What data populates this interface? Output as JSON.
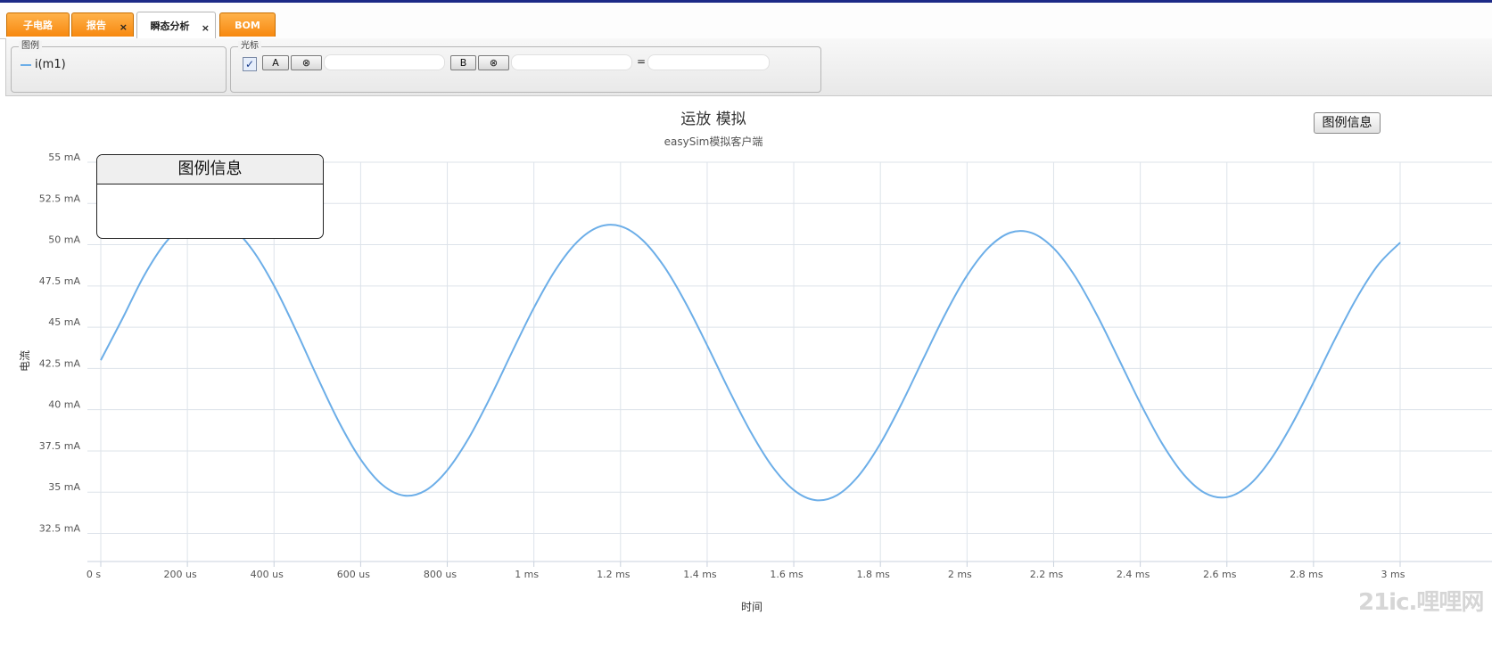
{
  "tabs": [
    {
      "label": "子电路",
      "active": false,
      "closable": false
    },
    {
      "label": "报告",
      "active": false,
      "closable": true
    },
    {
      "label": "瞬态分析",
      "active": true,
      "closable": true
    },
    {
      "label": "BOM",
      "active": false,
      "closable": false
    }
  ],
  "close_glyph": "×",
  "legend_panel": {
    "title": "图例",
    "entry": "i(m1)",
    "entry_color": "#6caee8"
  },
  "cursor_panel": {
    "title": "光标",
    "checkbox_checked": true,
    "checkbox_glyph": "✓",
    "a_label": "A",
    "b_label": "B",
    "clear_glyph": "⊗",
    "a_value": "",
    "b_value": "",
    "equals": "=",
    "diff_value": ""
  },
  "legend_info_button": "图例信息",
  "legend_info_popup": {
    "title": "图例信息"
  },
  "watermark": "21ic.哩哩网",
  "chart_data": {
    "type": "line",
    "title": "运放 模拟",
    "subtitle": "easySim模拟客户端",
    "xlabel": "时间",
    "ylabel": "电流",
    "x_ticks": [
      "0 s",
      "200 us",
      "400 us",
      "600 us",
      "800 us",
      "1 ms",
      "1.2 ms",
      "1.4 ms",
      "1.6 ms",
      "1.8 ms",
      "2 ms",
      "2.2 ms",
      "2.4 ms",
      "2.6 ms",
      "2.8 ms",
      "3 ms"
    ],
    "y_ticks": [
      "32.5 mA",
      "35 mA",
      "37.5 mA",
      "40 mA",
      "42.5 mA",
      "45 mA",
      "47.5 mA",
      "50 mA",
      "52.5 mA",
      "55 mA"
    ],
    "xlim": [
      0,
      3.0
    ],
    "ylim": [
      30.8,
      55
    ],
    "x_unit": "ms",
    "y_unit": "mA",
    "grid": true,
    "series": [
      {
        "name": "i(m1)",
        "color": "#6caee8",
        "x": [
          0,
          0.05,
          0.1,
          0.15,
          0.2,
          0.25,
          0.3,
          0.35,
          0.4,
          0.45,
          0.5,
          0.55,
          0.6,
          0.65,
          0.7,
          0.75,
          0.8,
          0.85,
          0.9,
          0.95,
          1.0,
          1.05,
          1.1,
          1.15,
          1.2,
          1.25,
          1.3,
          1.35,
          1.4,
          1.45,
          1.5,
          1.55,
          1.6,
          1.65,
          1.7,
          1.75,
          1.8,
          1.85,
          1.9,
          1.95,
          2.0,
          2.05,
          2.1,
          2.15,
          2.2,
          2.25,
          2.3,
          2.35,
          2.4,
          2.45,
          2.5,
          2.55,
          2.6,
          2.65,
          2.7,
          2.75,
          2.8,
          2.85,
          2.9,
          2.95,
          3.0
        ],
        "values": [
          43.0,
          45.52,
          48.13,
          50.14,
          51.35,
          51.69,
          51.12,
          49.69,
          47.52,
          44.85,
          41.98,
          39.25,
          36.99,
          35.45,
          34.8,
          35.11,
          36.33,
          38.3,
          40.79,
          43.52,
          46.18,
          48.48,
          50.17,
          51.08,
          51.12,
          50.3,
          48.7,
          46.49,
          43.91,
          41.21,
          38.68,
          36.57,
          35.13,
          34.52,
          34.82,
          36.01,
          37.95,
          40.42,
          43.14,
          45.81,
          48.13,
          49.83,
          50.73,
          50.71,
          49.78,
          48.06,
          45.74,
          43.09,
          40.4,
          37.97,
          36.08,
          34.94,
          34.7,
          35.4,
          36.94,
          39.11,
          41.65,
          44.31,
          46.78,
          48.8,
          50.13
        ]
      }
    ]
  }
}
